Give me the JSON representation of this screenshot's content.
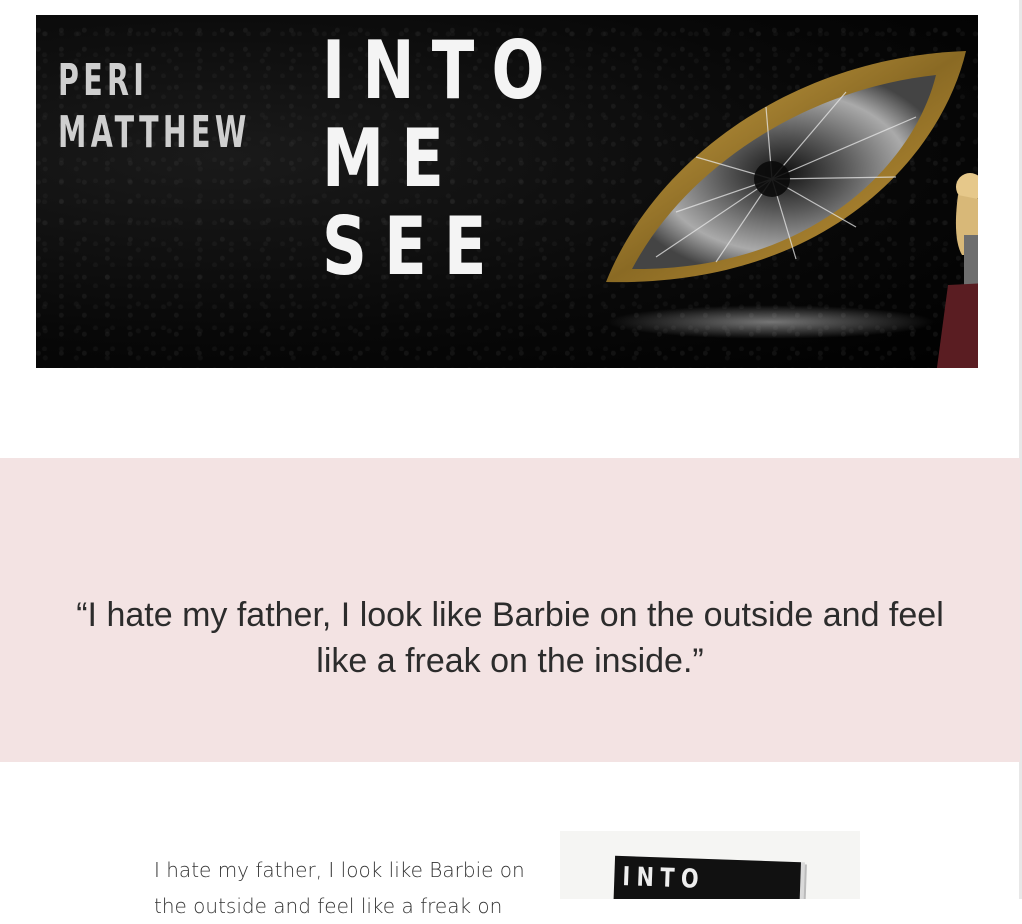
{
  "banner": {
    "author_line1": "PERI",
    "author_line2": "MATTHEW",
    "title_line1": "INTO",
    "title_line2": "ME",
    "title_line3": "SEE"
  },
  "quote": {
    "text": "“I hate my father, I look like Barbie on the outside and feel like a freak on the inside.”"
  },
  "intro": {
    "text": "I hate my father, I look like Barbie on the outside and feel like a freak on"
  },
  "book_cover": {
    "title": "INTO"
  },
  "colors": {
    "quote_band": "#f3e3e3",
    "banner_bg": "#000000",
    "eye_frame": "#b88a2c"
  }
}
